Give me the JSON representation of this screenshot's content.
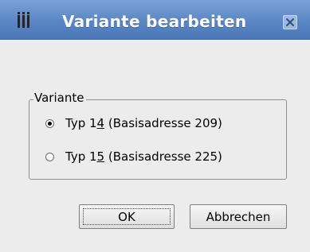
{
  "window": {
    "title": "Variante bearbeiten"
  },
  "titlebar": {
    "app_icon": "app-bars-icon",
    "close_icon": "close-icon"
  },
  "group": {
    "label": "Variante",
    "options": [
      {
        "prefix": "Typ 1",
        "mnemonic": "4",
        "suffix": " (Basisadresse 209)",
        "checked": true
      },
      {
        "prefix": "Typ 1",
        "mnemonic": "5",
        "suffix": " (Basisadresse 225)",
        "checked": false
      }
    ]
  },
  "buttons": {
    "ok_label": "OK",
    "cancel_label": "Abbrechen"
  },
  "colors": {
    "titlebar": "#5b86c4",
    "background": "#ececec"
  }
}
